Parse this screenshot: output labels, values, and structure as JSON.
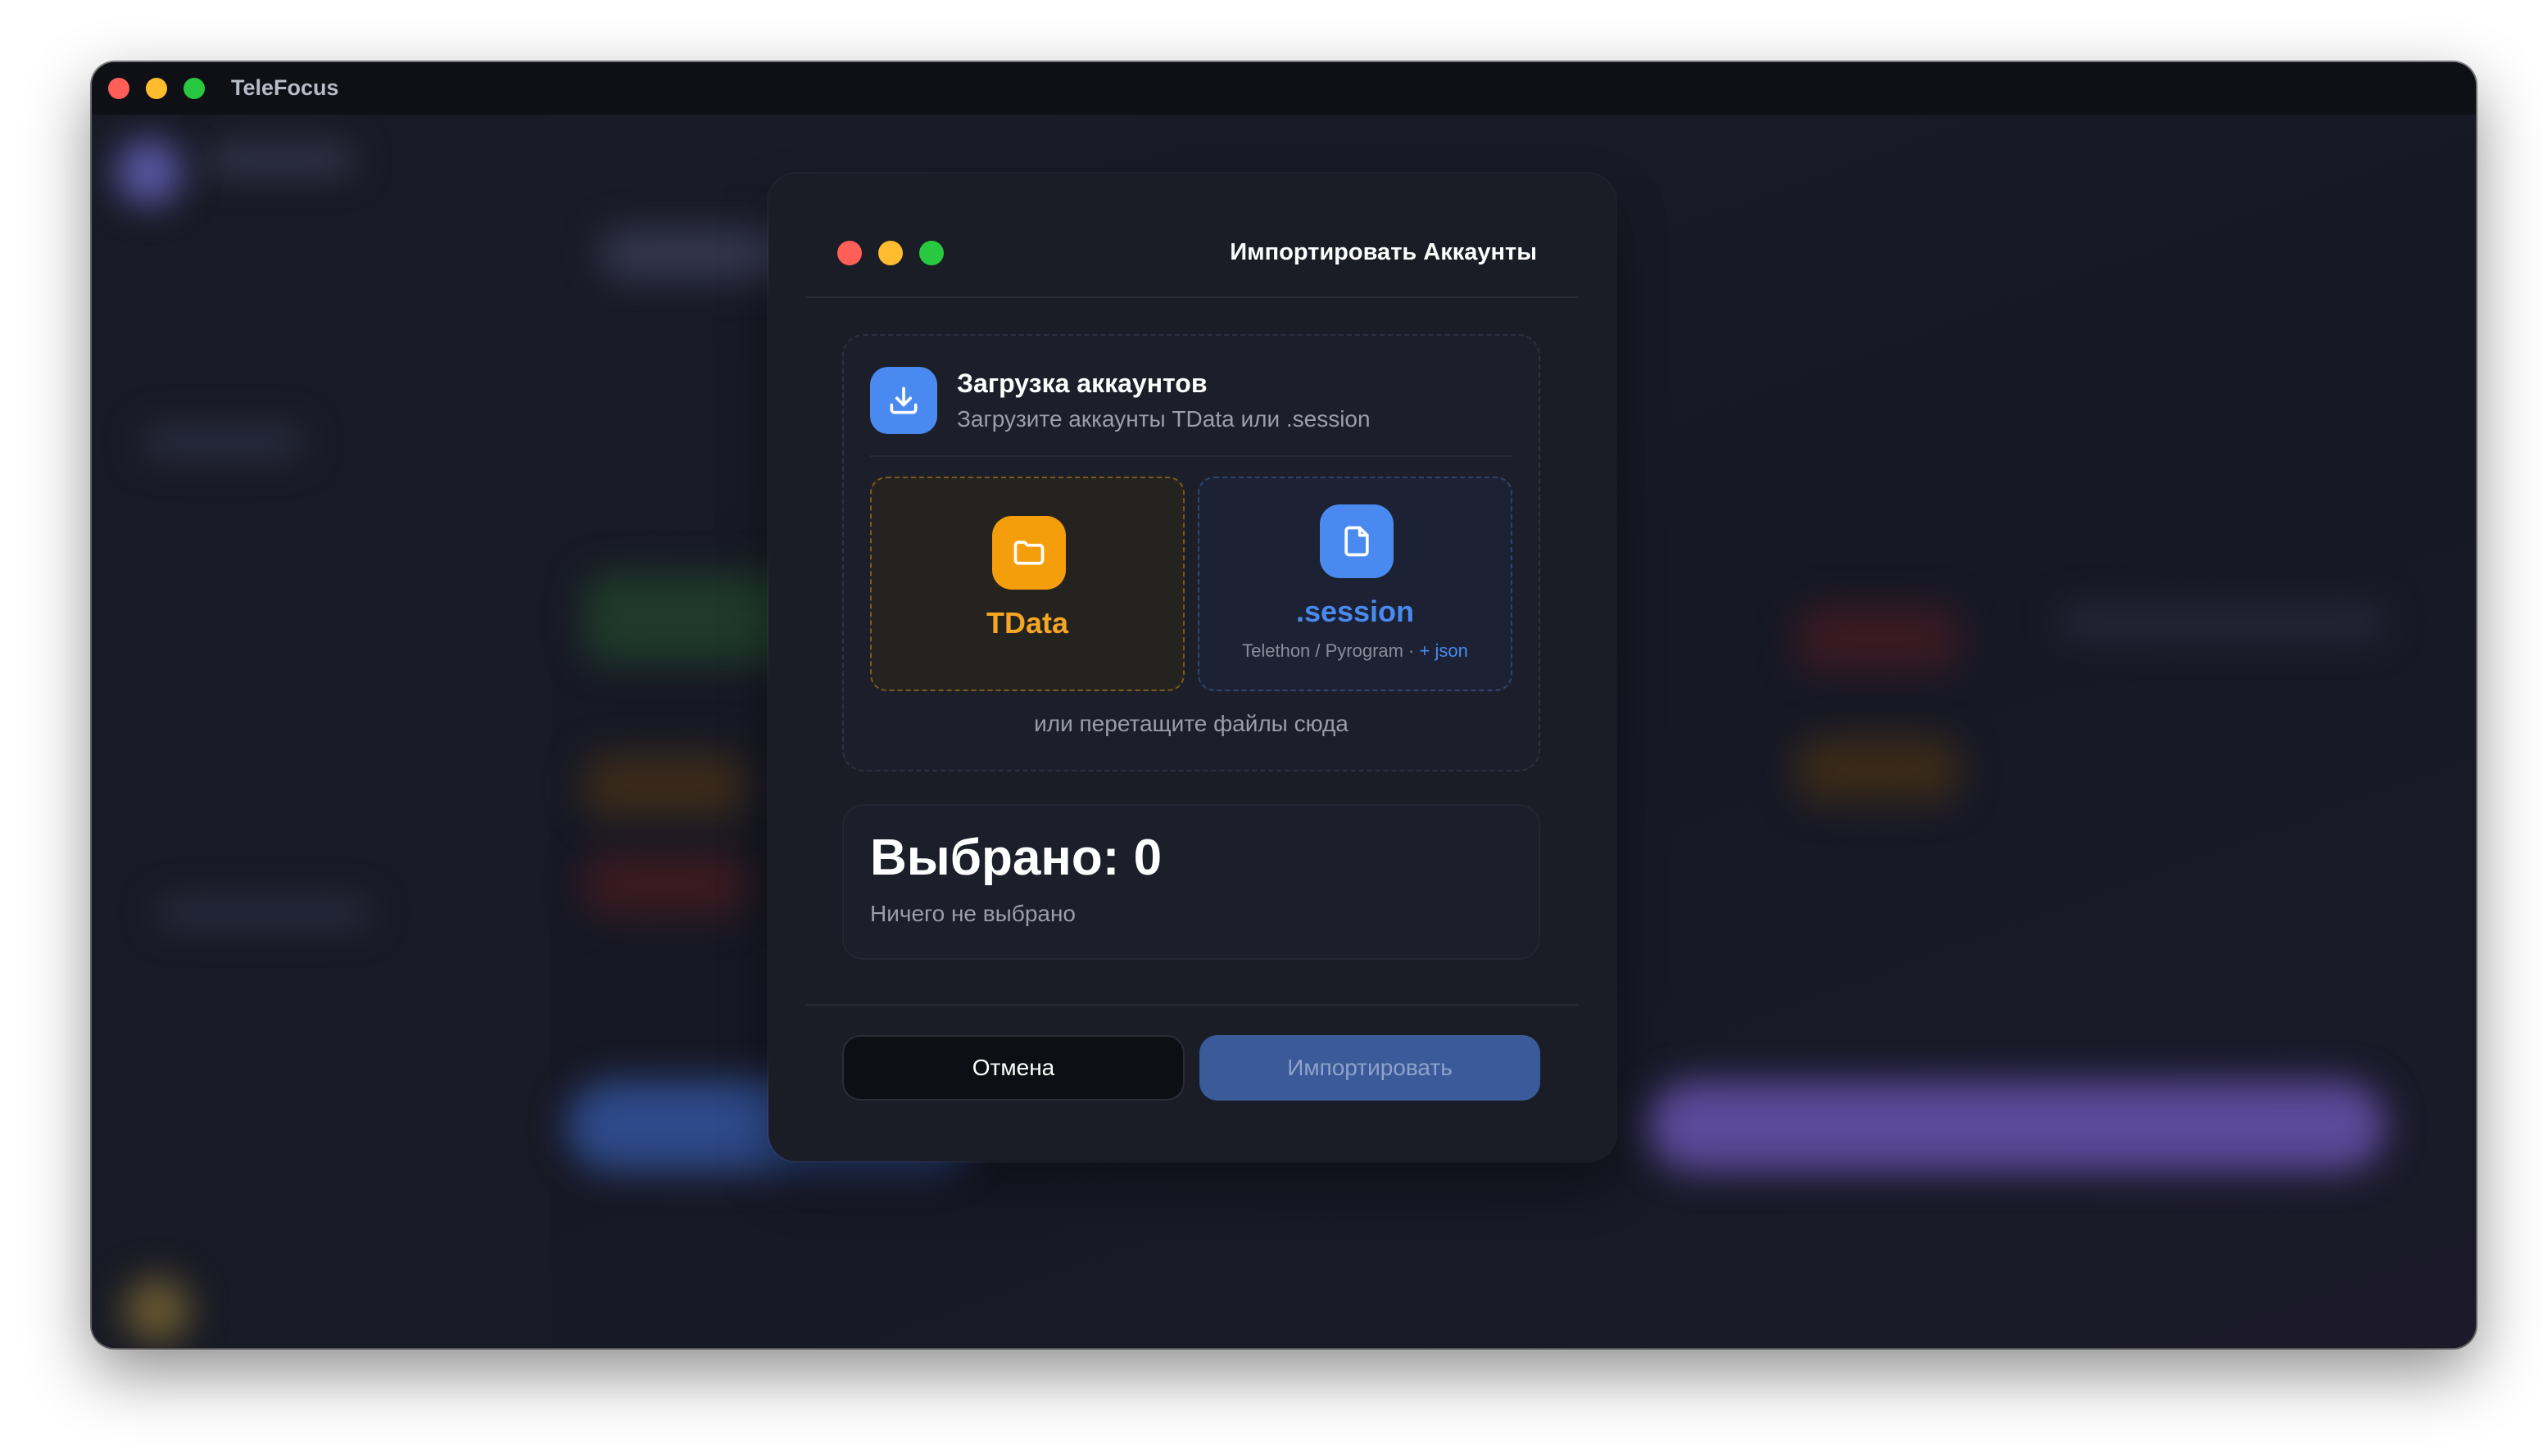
{
  "app": {
    "title": "TeleFocus"
  },
  "dialog": {
    "title": "Импортировать Аккаунты",
    "upload": {
      "title": "Загрузка аккаунтов",
      "subtitle": "Загрузите аккаунты TData или .session",
      "tdata_label": "TData",
      "session_label": ".session",
      "session_sub": "Telethon / Pyrogram · ",
      "session_sub_accent": "+ json",
      "drop_hint": "или перетащите файлы сюда"
    },
    "selection": {
      "title": "Выбрано: 0",
      "subtitle": "Ничего не выбрано"
    },
    "buttons": {
      "cancel": "Отмена",
      "import": "Импортировать"
    }
  },
  "colors": {
    "accent_blue": "#4a8af0",
    "accent_orange": "#f59e0b",
    "import_button": "#3b5a9a"
  },
  "icons": {
    "upload": "download-tray-icon",
    "tdata": "folder-icon",
    "session": "file-icon"
  }
}
